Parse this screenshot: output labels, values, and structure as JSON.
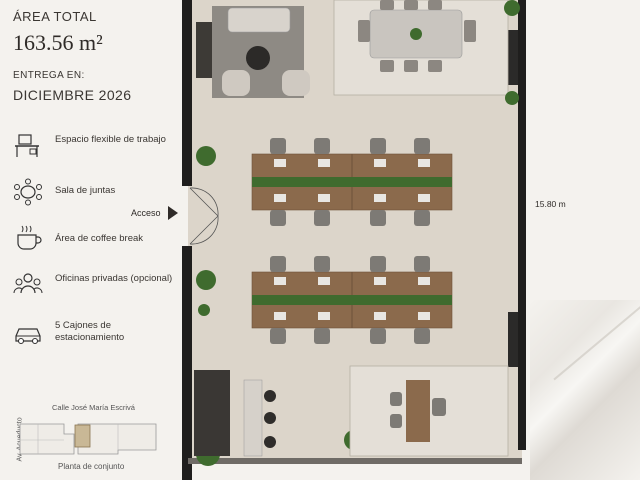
{
  "header": {
    "area_label": "ÁREA TOTAL",
    "area_value": "163.56 m²",
    "delivery_label": "ENTREGA EN:",
    "delivery_value": "DICIEMBRE 2026"
  },
  "features": [
    {
      "icon": "desk-icon",
      "label": "Espacio flexible de trabajo"
    },
    {
      "icon": "meeting-table-icon",
      "label": "Sala de juntas"
    },
    {
      "icon": "coffee-cup-icon",
      "label": "Área de coffee break"
    },
    {
      "icon": "people-icon",
      "label": "Oficinas privadas (opcional)"
    },
    {
      "icon": "car-icon",
      "label": "5 Cajones de estacionamiento"
    }
  ],
  "site_plan": {
    "street_top": "Calle José María Escrivá",
    "street_side": "Av. Acueducto",
    "caption": "Planta de conjunto"
  },
  "plan": {
    "entrance_label": "Acceso",
    "dimension_label": "15.80 m"
  },
  "colors": {
    "floor": "#ddd6cb",
    "wood": "#8b6a4c",
    "wall": "#1e1d1c",
    "plant": "#3f6b2e",
    "text": "#3a3632"
  }
}
